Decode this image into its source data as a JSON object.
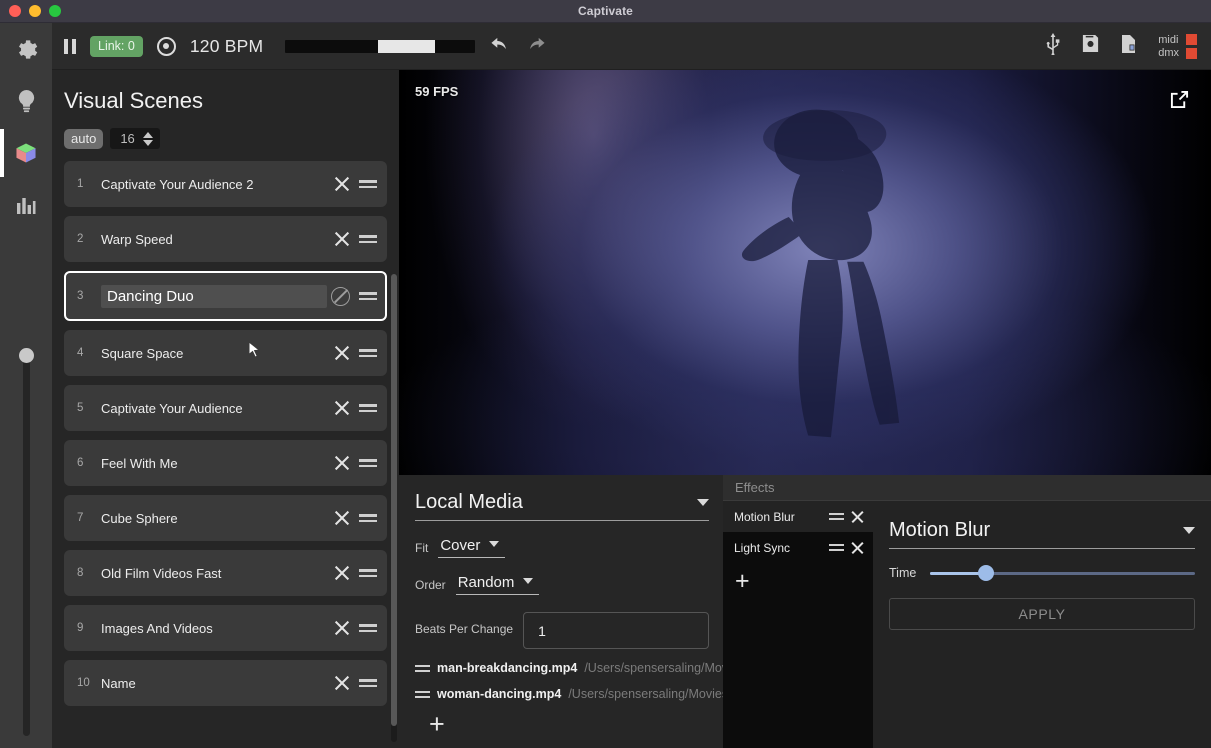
{
  "window": {
    "title": "Captivate",
    "traffic_lights": [
      "close",
      "minimize",
      "zoom"
    ]
  },
  "toolbar": {
    "pause_label": "pause",
    "link_label": "Link: 0",
    "metronome_label": "metronome",
    "bpm": "120 BPM",
    "undo_label": "undo",
    "redo_label": "redo",
    "usb_label": "usb",
    "save_label": "save",
    "file_label": "file",
    "midi_label": "midi",
    "dmx_label": "dmx",
    "accent_green": "#63a364",
    "led_color": "#e04a33"
  },
  "rail": {
    "items": [
      {
        "name": "settings",
        "icon": "gear-icon"
      },
      {
        "name": "lights",
        "icon": "lightbulb-icon"
      },
      {
        "name": "visuals",
        "icon": "cube-icon",
        "active": true
      },
      {
        "name": "audio",
        "icon": "bar-chart-icon"
      }
    ],
    "brightness_slider_value": 92
  },
  "scenes": {
    "title": "Visual Scenes",
    "auto_label": "auto",
    "count_value": "16",
    "items": [
      {
        "num": "1",
        "name": "Captivate Your Audience 2"
      },
      {
        "num": "2",
        "name": "Warp Speed"
      },
      {
        "num": "3",
        "name": "Dancing Duo",
        "selected": true
      },
      {
        "num": "4",
        "name": "Square Space"
      },
      {
        "num": "5",
        "name": "Captivate Your Audience"
      },
      {
        "num": "6",
        "name": "Feel With Me"
      },
      {
        "num": "7",
        "name": "Cube Sphere"
      },
      {
        "num": "8",
        "name": "Old Film Videos Fast"
      },
      {
        "num": "9",
        "name": "Images And Videos"
      },
      {
        "num": "10",
        "name": "Name"
      }
    ]
  },
  "preview": {
    "fps": "59 FPS",
    "popout_label": "open in new window"
  },
  "local_media": {
    "title": "Local Media",
    "fit_label": "Fit",
    "fit_value": "Cover",
    "order_label": "Order",
    "order_value": "Random",
    "beats_label": "Beats Per Change",
    "beats_value": "1",
    "files": [
      {
        "name": "man-breakdancing.mp4",
        "path": "/Users/spensersaling/Movi"
      },
      {
        "name": "woman-dancing.mp4",
        "path": "/Users/spensersaling/Movies"
      }
    ],
    "add_label": "+"
  },
  "effects": {
    "header": "Effects",
    "items": [
      {
        "name": "Motion Blur",
        "selected": true
      },
      {
        "name": "Light Sync",
        "selected": false
      }
    ],
    "add_label": "+",
    "detail": {
      "title": "Motion Blur",
      "slider_label": "Time",
      "slider_value": 21,
      "apply_label": "APPLY",
      "slider_color": "#9dbce8"
    }
  }
}
